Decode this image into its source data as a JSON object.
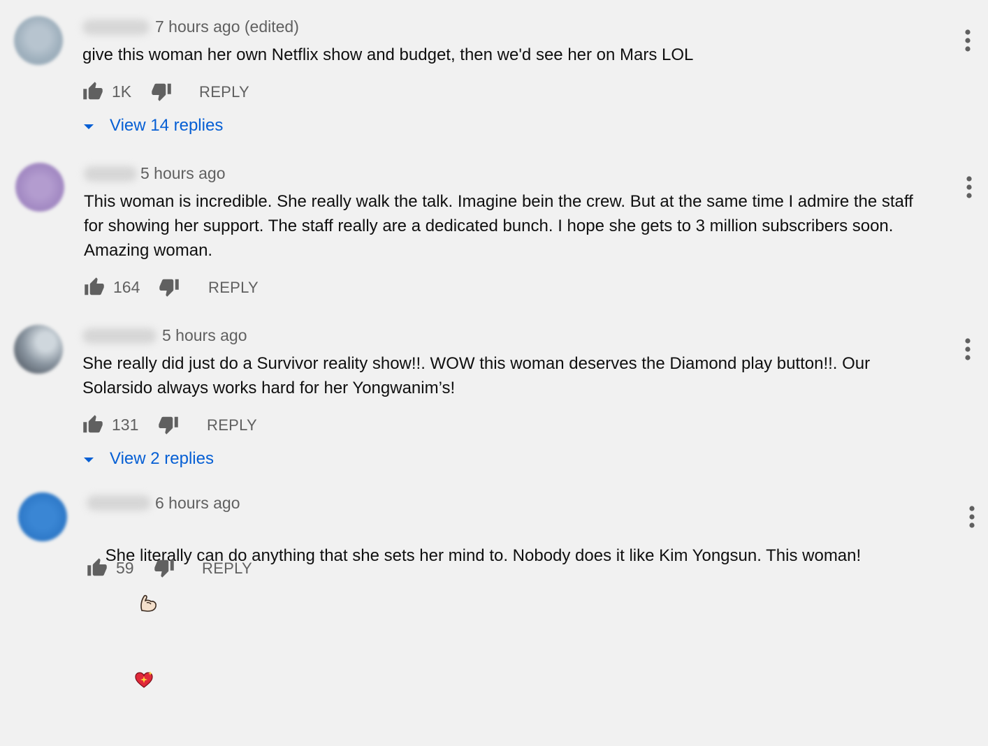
{
  "comments": [
    {
      "time": "7 hours ago (edited)",
      "text": "give this woman her own Netflix show and budget, then we'd see her on Mars LOL",
      "likes": "1K",
      "reply_label": "REPLY",
      "view_replies": "View 14 replies"
    },
    {
      "time": "5 hours ago",
      "text": "This woman is incredible. She really walk the talk. Imagine bein the crew. But at the same time I admire the staff for showing her support. The staff really are a dedicated bunch. I hope she gets to 3 million subscribers soon. Amazing woman.",
      "likes": "164",
      "reply_label": "REPLY"
    },
    {
      "time": "5 hours ago",
      "text": "She really did just do a Survivor reality show!!. WOW this woman deserves the Diamond play button!!. Our Solarsido always works hard for her Yongwanim’s!",
      "likes": "131",
      "reply_label": "REPLY",
      "view_replies": "View 2 replies"
    },
    {
      "time": "6 hours ago",
      "text": "She literally can do anything that she sets her mind to. Nobody does it like Kim Yongsun. This woman!",
      "likes": "59",
      "reply_label": "REPLY",
      "emojis": [
        "flexed-biceps-emoji",
        "sparkling-heart-emoji"
      ]
    }
  ],
  "icons": {
    "like": "thumbs-up-icon",
    "dislike": "thumbs-down-icon",
    "menu": "more-vertical-icon",
    "expand": "caret-down-icon"
  },
  "colors": {
    "background": "#f1f1f1",
    "link_blue": "#065fd4",
    "secondary_text": "#606060",
    "icon_gray": "#606060"
  }
}
